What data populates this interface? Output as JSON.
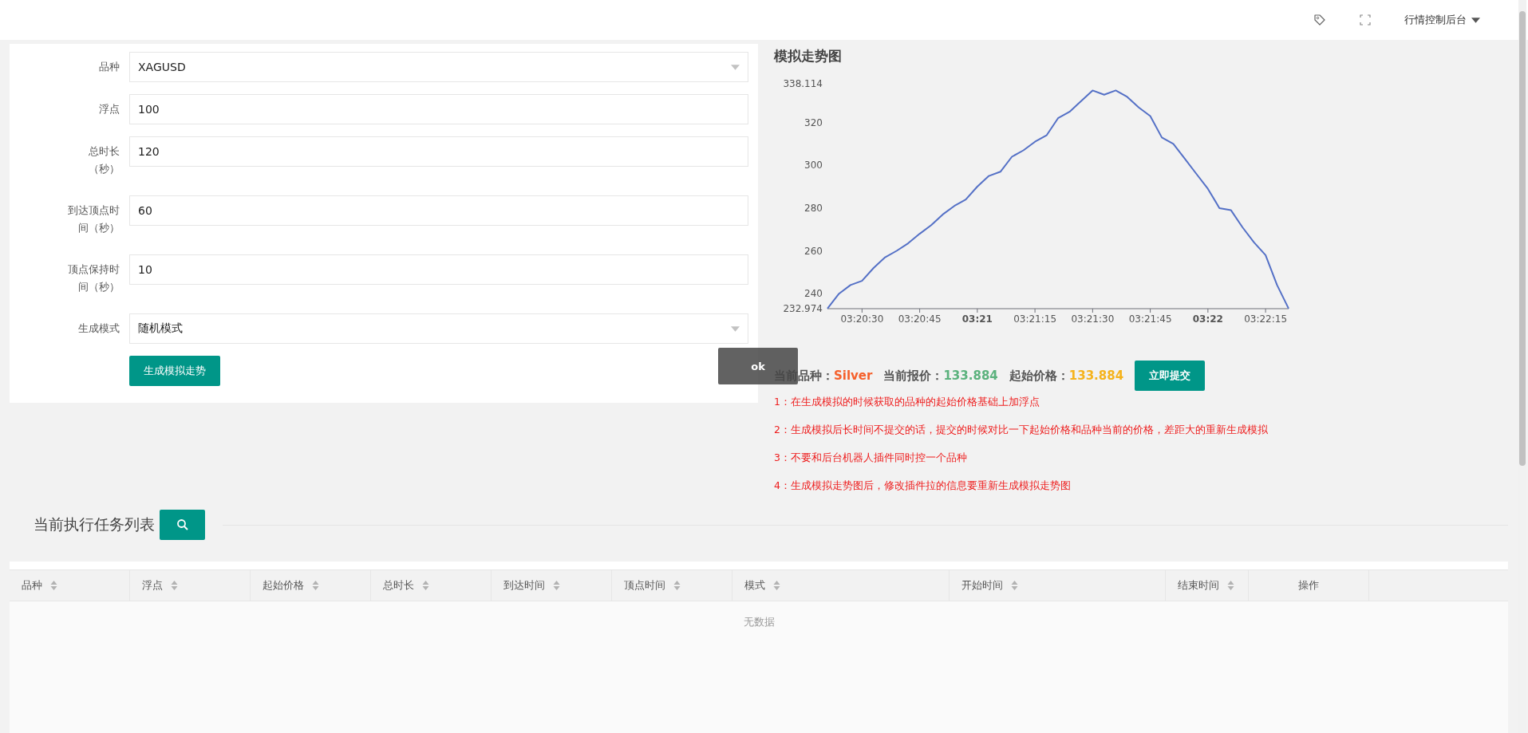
{
  "header": {
    "user_menu": "行情控制后台"
  },
  "form": {
    "fields": [
      {
        "label": "品种",
        "value": "XAGUSD",
        "kind": "select"
      },
      {
        "label": "浮点",
        "value": "100",
        "kind": "input"
      },
      {
        "label": "总时长（秒）",
        "value": "120",
        "kind": "input"
      },
      {
        "label": "到达顶点时间（秒）",
        "value": "60",
        "kind": "input"
      },
      {
        "label": "顶点保持时间（秒）",
        "value": "10",
        "kind": "input"
      },
      {
        "label": "生成模式",
        "value": "随机模式",
        "kind": "select"
      }
    ],
    "button": "生成模拟走势"
  },
  "chart": {
    "title": "模拟走势图",
    "chart_data": {
      "type": "line",
      "categories": [
        null,
        null,
        null,
        "03:20:30",
        null,
        null,
        null,
        null,
        "03:20:45",
        null,
        null,
        null,
        null,
        "03:21",
        null,
        null,
        null,
        null,
        "03:21:15",
        null,
        null,
        null,
        null,
        "03:21:30",
        null,
        null,
        null,
        null,
        "03:21:45",
        null,
        null,
        null,
        null,
        "03:22",
        null,
        null,
        null,
        null,
        "03:22:15",
        null,
        null
      ],
      "values": [
        233,
        240,
        244,
        246,
        252,
        257,
        260,
        263.5,
        268,
        272,
        277,
        281,
        284,
        290,
        295,
        297,
        304,
        307,
        311,
        314,
        322,
        325,
        330,
        335,
        333,
        335,
        332,
        327,
        323,
        313,
        310,
        303,
        296,
        289,
        280,
        279,
        271,
        264,
        258,
        244,
        233
      ],
      "ylim": [
        232.974,
        338.114
      ],
      "yticks": [
        {
          "value": 232.974,
          "label": "232.974"
        },
        240,
        260,
        280,
        300,
        320,
        {
          "value": 338.114,
          "label": "338.114"
        }
      ]
    }
  },
  "quote": {
    "symbol_label": "当前品种：",
    "symbol": "Silver",
    "price_label": "当前报价：",
    "price": "133.884",
    "start_label": "起始价格：",
    "start_price": "133.884",
    "submit": "立即提交"
  },
  "notes": [
    "1：在生成模拟的时候获取的品种的起始价格基础上加浮点",
    "2：生成模拟后长时间不提交的话，提交的时候对比一下起始价格和品种当前的价格，差距大的重新生成模拟",
    "3：不要和后台机器人插件同时控一个品种",
    "4：生成模拟走势图后，修改插件拉的信息要重新生成模拟走势图"
  ],
  "toast": "ok",
  "tasks": {
    "title": "当前执行任务列表",
    "columns": [
      {
        "label": "品种",
        "sortable": true
      },
      {
        "label": "浮点",
        "sortable": true
      },
      {
        "label": "起始价格",
        "sortable": true
      },
      {
        "label": "总时长",
        "sortable": true
      },
      {
        "label": "到达时间",
        "sortable": true
      },
      {
        "label": "顶点时间",
        "sortable": true
      },
      {
        "label": "模式",
        "sortable": true
      },
      {
        "label": "开始时间",
        "sortable": true
      },
      {
        "label": "结束时间",
        "sortable": true
      },
      {
        "label": "操作",
        "sortable": false
      }
    ],
    "empty_text": "无数据"
  }
}
